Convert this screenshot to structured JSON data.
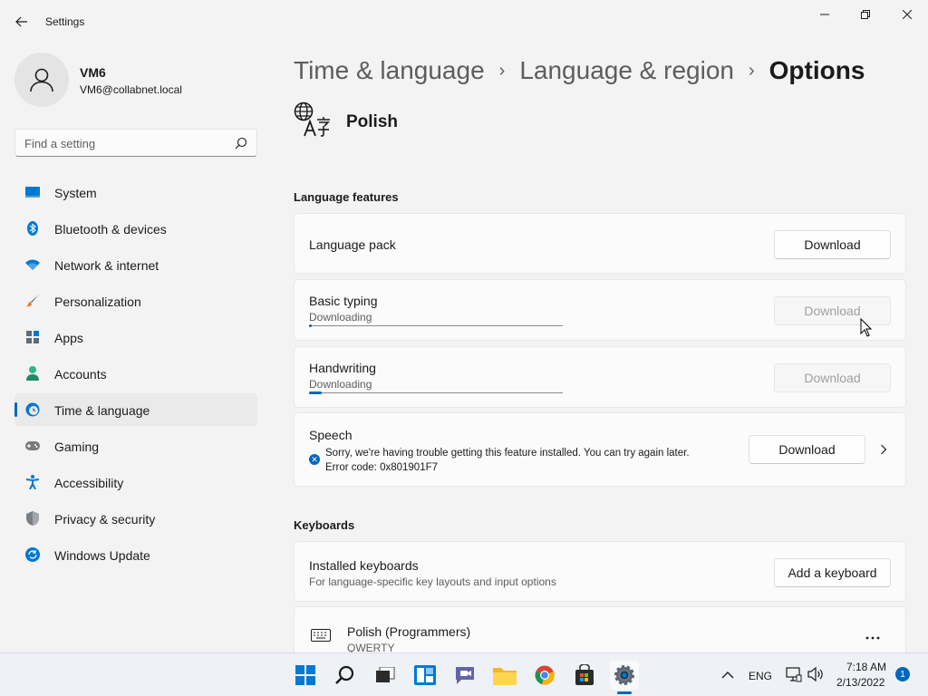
{
  "window": {
    "title": "Settings",
    "controls": [
      "minimize",
      "restore",
      "close"
    ]
  },
  "user": {
    "name": "VM6",
    "email": "VM6@collabnet.local"
  },
  "search": {
    "placeholder": "Find a setting"
  },
  "sidebar": {
    "items": [
      {
        "label": "System",
        "icon": "system-icon"
      },
      {
        "label": "Bluetooth & devices",
        "icon": "bluetooth-icon"
      },
      {
        "label": "Network & internet",
        "icon": "wifi-icon"
      },
      {
        "label": "Personalization",
        "icon": "brush-icon"
      },
      {
        "label": "Apps",
        "icon": "apps-icon"
      },
      {
        "label": "Accounts",
        "icon": "accounts-icon"
      },
      {
        "label": "Time & language",
        "icon": "time-language-icon",
        "active": true
      },
      {
        "label": "Gaming",
        "icon": "gamepad-icon"
      },
      {
        "label": "Accessibility",
        "icon": "accessibility-icon"
      },
      {
        "label": "Privacy & security",
        "icon": "shield-icon"
      },
      {
        "label": "Windows Update",
        "icon": "windows-update-icon"
      }
    ]
  },
  "breadcrumb": {
    "items": [
      "Time & language",
      "Language & region"
    ],
    "separator": "›",
    "current": "Options"
  },
  "language": {
    "name": "Polish"
  },
  "language_features": {
    "title": "Language features",
    "language_pack": {
      "title": "Language pack",
      "button": "Download"
    },
    "basic_typing": {
      "title": "Basic typing",
      "status": "Downloading",
      "button": "Download",
      "progress": 0.01
    },
    "handwriting": {
      "title": "Handwriting",
      "status": "Downloading",
      "button": "Download",
      "progress": 0.05
    },
    "speech": {
      "title": "Speech",
      "error": "Sorry, we're having trouble getting this feature installed. You can try again later. Error code: 0x801901F7",
      "button": "Download"
    }
  },
  "keyboards": {
    "title": "Keyboards",
    "installed": {
      "title": "Installed keyboards",
      "subtitle": "For language-specific key layouts and input options",
      "button": "Add a keyboard"
    },
    "items": [
      {
        "title": "Polish (Programmers)",
        "subtitle": "QWERTY"
      }
    ]
  },
  "taskbar": {
    "tray": {
      "language": "ENG",
      "time": "7:18 AM",
      "date": "2/13/2022",
      "notifications": "1"
    }
  },
  "colors": {
    "accent": "#0067c0",
    "background": "#f3f3f3",
    "card": "#fbfbfb"
  }
}
